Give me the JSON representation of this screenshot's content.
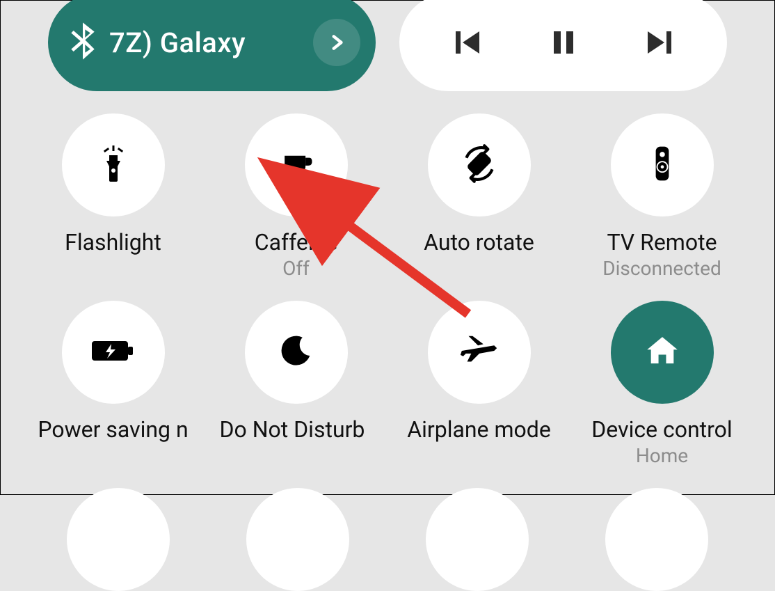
{
  "colors": {
    "accent": "#23796e",
    "arrow": "#e5352b"
  },
  "top": {
    "bluetooth": {
      "label": "7Z)     Galaxy"
    },
    "media": {}
  },
  "tiles": [
    {
      "id": "flashlight",
      "label": "Flashlight",
      "sub": "",
      "active": false,
      "icon": "flashlight"
    },
    {
      "id": "caffeine",
      "label": "Caffeine",
      "sub": "Off",
      "active": false,
      "icon": "coffee"
    },
    {
      "id": "autorotate",
      "label": "Auto rotate",
      "sub": "",
      "active": false,
      "icon": "rotate"
    },
    {
      "id": "tvremote",
      "label": "TV Remote",
      "sub": "Disconnected",
      "active": false,
      "icon": "remote"
    },
    {
      "id": "powersaving",
      "label": "Power saving n",
      "sub": "",
      "active": false,
      "icon": "battery"
    },
    {
      "id": "dnd",
      "label": "Do Not Disturb",
      "sub": "",
      "active": false,
      "icon": "moon",
      "dropdown": true
    },
    {
      "id": "airplane",
      "label": "Airplane mode",
      "sub": "",
      "active": false,
      "icon": "plane"
    },
    {
      "id": "devicecontrol",
      "label": "Device control",
      "sub": "Home",
      "active": true,
      "icon": "home"
    }
  ]
}
